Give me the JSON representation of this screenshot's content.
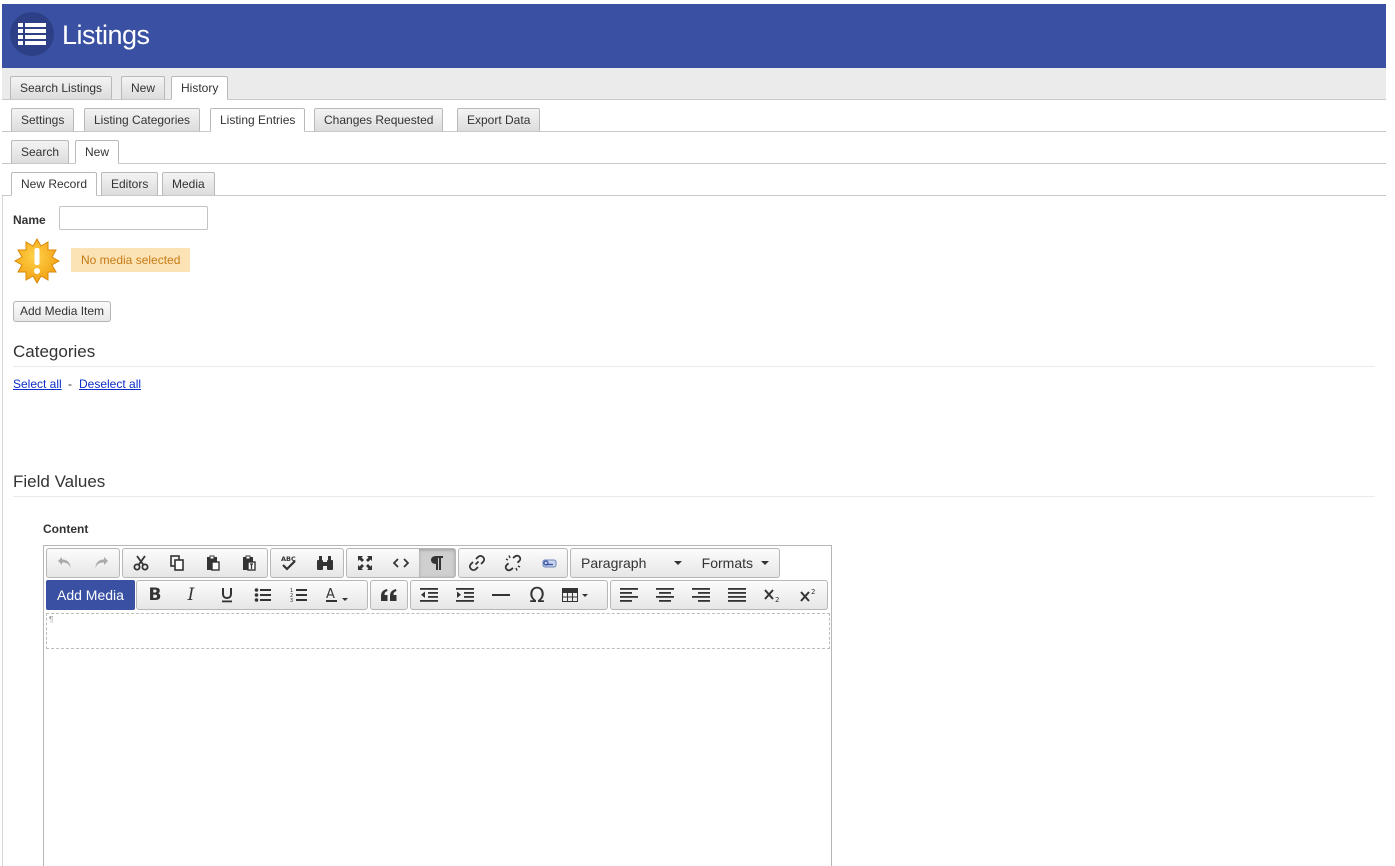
{
  "app": {
    "title": "Listings",
    "icon": "list-icon",
    "brand_color": "#3a51a3"
  },
  "tabs_level1": [
    {
      "label": "Search Listings",
      "active": false
    },
    {
      "label": "New",
      "active": false
    },
    {
      "label": "History",
      "active": true
    }
  ],
  "tabs_level2": [
    {
      "label": "Settings",
      "active": false
    },
    {
      "label": "Listing Categories",
      "active": false
    },
    {
      "label": "Listing Entries",
      "active": true
    },
    {
      "label": "Changes Requested",
      "active": false
    },
    {
      "label": "Export Data",
      "active": false
    }
  ],
  "tabs_level3": [
    {
      "label": "Search",
      "active": false
    },
    {
      "label": "New",
      "active": true
    }
  ],
  "tabs_level4": [
    {
      "label": "New Record",
      "active": true
    },
    {
      "label": "Editors",
      "active": false
    },
    {
      "label": "Media",
      "active": false
    }
  ],
  "form": {
    "name_label": "Name",
    "name_value": "",
    "media_notice": "No media selected",
    "add_media_item": "Add Media Item"
  },
  "categories": {
    "title": "Categories",
    "select_all": "Select all",
    "separator": "-",
    "deselect_all": "Deselect all"
  },
  "field_values": {
    "title": "Field Values",
    "content_label": "Content"
  },
  "editor": {
    "add_media": "Add Media",
    "block_format": "Paragraph",
    "formats": "Formats",
    "row1_icons": [
      "undo-icon",
      "redo-icon",
      "cut-icon",
      "copy-icon",
      "paste-icon",
      "paste-text-icon",
      "spellcheck-icon",
      "find-replace-icon",
      "fullscreen-icon",
      "source-code-icon",
      "show-blocks-icon",
      "link-icon",
      "unlink-icon",
      "anchor-icon"
    ],
    "row2_icons": [
      "bold-icon",
      "italic-icon",
      "underline-icon",
      "bullet-list-icon",
      "numbered-list-icon",
      "text-color-icon",
      "blockquote-icon",
      "outdent-icon",
      "indent-icon",
      "horizontal-rule-icon",
      "special-char-icon",
      "table-icon",
      "align-left-icon",
      "align-center-icon",
      "align-right-icon",
      "align-justify-icon",
      "subscript-icon",
      "superscript-icon"
    ]
  }
}
